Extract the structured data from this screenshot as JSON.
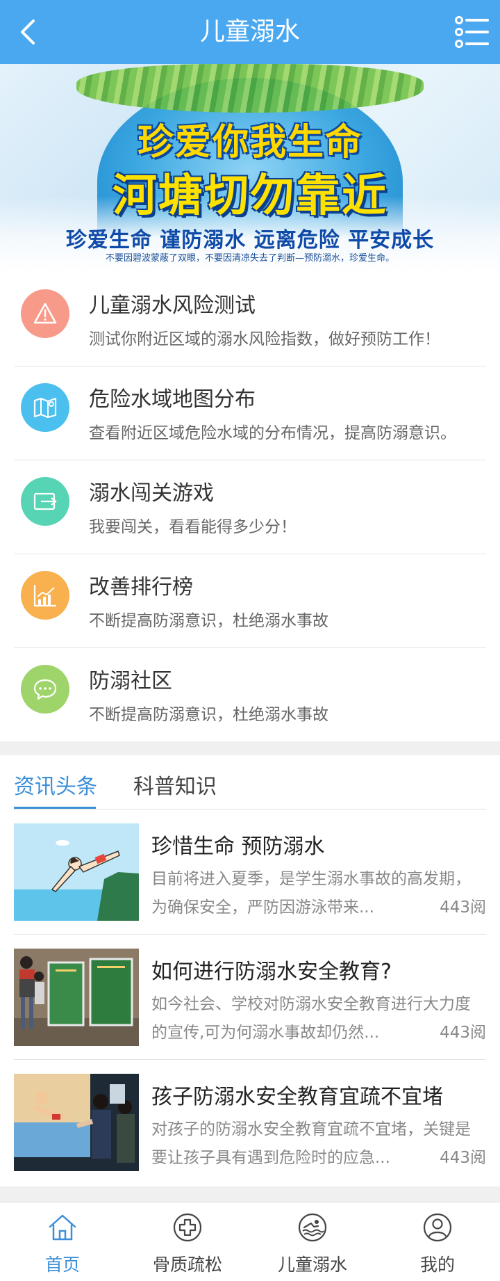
{
  "header": {
    "title": "儿童溺水",
    "back_icon": "chevron-left-icon",
    "menu_icon": "list-menu-icon",
    "bg_color": "#4aa8f0"
  },
  "banner": {
    "line1": "珍爱你我生命",
    "line2": "河塘切勿靠近",
    "slogan": "珍爱生命 谨防溺水 远离危险 平安成长",
    "small": "不要因碧波蒙蔽了双眼，不要因清凉失去了判断—预防溺水，珍爱生命。"
  },
  "features": [
    {
      "title": "儿童溺水风险测试",
      "desc": "测试你附近区域的溺水风险指数，做好预防工作！",
      "icon": "warning-icon",
      "color": "#f89a8a"
    },
    {
      "title": "危险水域地图分布",
      "desc": "查看附近区域危险水域的分布情况，提高防溺意识。",
      "icon": "map-icon",
      "color": "#4bc0ee"
    },
    {
      "title": "溺水闯关游戏",
      "desc": "我要闯关，看看能得多少分！",
      "icon": "exit-icon",
      "color": "#56d4b4"
    },
    {
      "title": "改善排行榜",
      "desc": "不断提高防溺意识，杜绝溺水事故",
      "icon": "chart-icon",
      "color": "#f9b04e"
    },
    {
      "title": "防溺社区",
      "desc": "不断提高防溺意识，杜绝溺水事故",
      "icon": "chat-icon",
      "color": "#9fd46a"
    }
  ],
  "news": {
    "tabs": [
      "资讯头条",
      "科普知识"
    ],
    "active_tab": 0,
    "items": [
      {
        "title": "珍惜生命 预防溺水",
        "desc1": "目前将进入夏季，是学生溺水事故的高发期，",
        "desc2": "为确保安全，严防因游泳带来...",
        "reads": "443阅"
      },
      {
        "title": "如何进行防溺水安全教育?",
        "desc1": "如今社会、学校对防溺水安全教育进行大力度",
        "desc2": "的宣传,可为何溺水事故却仍然...",
        "reads": "443阅"
      },
      {
        "title": "孩子防溺水安全教育宜疏不宜堵",
        "desc1": "对孩子的防溺水安全教育宜疏不宜堵，关键是",
        "desc2": "要让孩子具有遇到危险时的应急...",
        "reads": "443阅"
      }
    ]
  },
  "tabbar": [
    {
      "label": "首页",
      "icon": "home-icon",
      "active": true
    },
    {
      "label": "骨质疏松",
      "icon": "medical-cross-icon",
      "active": false
    },
    {
      "label": "儿童溺水",
      "icon": "swimmer-icon",
      "active": false
    },
    {
      "label": "我的",
      "icon": "user-icon",
      "active": false
    }
  ],
  "accent_color": "#3b8fd8"
}
